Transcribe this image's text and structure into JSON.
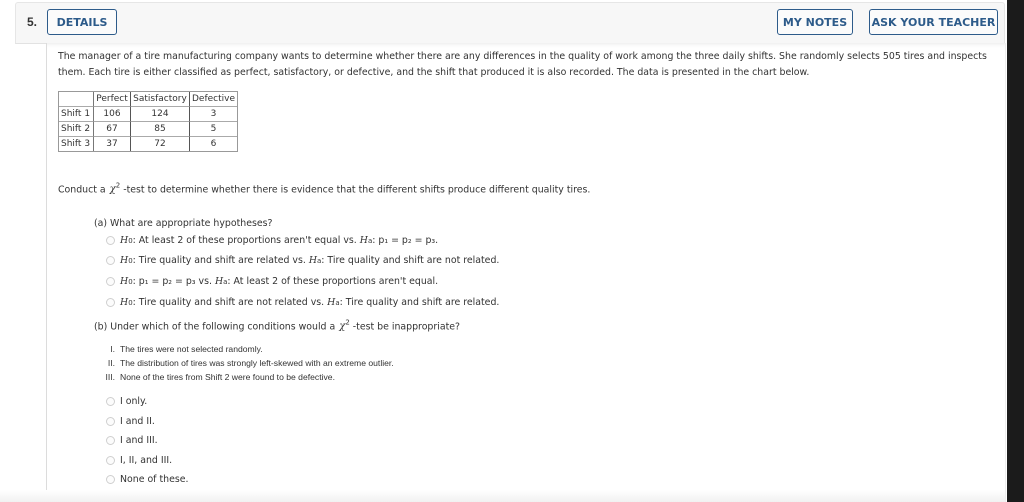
{
  "question": {
    "number": "5.",
    "details_label": "DETAILS",
    "my_notes_label": "MY NOTES",
    "ask_teacher_label": "ASK YOUR TEACHER"
  },
  "intro": "The manager of a tire manufacturing company wants to determine whether there are any differences in the quality of work among the three daily shifts. She randomly selects 505 tires and inspects them. Each tire is either classified as perfect, satisfactory, or defective, and the shift that produced it is also recorded. The data is presented in the chart below.",
  "table": {
    "headers": [
      "",
      "Perfect",
      "Satisfactory",
      "Defective"
    ],
    "rows": [
      [
        "Shift 1",
        "106",
        "124",
        "3"
      ],
      [
        "Shift 2",
        "67",
        "85",
        "5"
      ],
      [
        "Shift 3",
        "37",
        "72",
        "6"
      ]
    ]
  },
  "conduct": {
    "before": "Conduct a",
    "chi": "χ",
    "sup": "2",
    "after": "-test to determine whether there is evidence that the different shifts produce different quality tires."
  },
  "part_a": {
    "prompt": "(a) What are appropriate hypotheses?",
    "options": [
      {
        "h0_label": "H",
        "h0_sub": "0",
        "h0_text": ": At least 2 of these proportions aren't equal vs. ",
        "ha_label": "H",
        "ha_sub": "a",
        "ha_text": ": p₁ = p₂ = p₃."
      },
      {
        "h0_label": "H",
        "h0_sub": "0",
        "h0_text": ": Tire quality and shift are related vs. ",
        "ha_label": "H",
        "ha_sub": "a",
        "ha_text": ": Tire quality and shift are not related."
      },
      {
        "h0_label": "H",
        "h0_sub": "0",
        "h0_text": ": p₁ = p₂ = p₃ vs. ",
        "ha_label": "H",
        "ha_sub": "a",
        "ha_text": ": At least 2 of these proportions aren't equal."
      },
      {
        "h0_label": "H",
        "h0_sub": "0",
        "h0_text": ": Tire quality and shift are not related vs. ",
        "ha_label": "H",
        "ha_sub": "a",
        "ha_text": ": Tire quality and shift are related."
      }
    ]
  },
  "part_b": {
    "prompt_before": "(b) Under which of the following conditions would a",
    "chi": "χ",
    "sup": "2",
    "prompt_after": "-test be inappropriate?",
    "conditions": [
      {
        "num": "I.",
        "text": "The tires were not selected randomly."
      },
      {
        "num": "II.",
        "text": "The distribution of tires was strongly left-skewed with an extreme outlier."
      },
      {
        "num": "III.",
        "text": "None of the tires from Shift 2 were found to be defective."
      }
    ],
    "options": [
      "I only.",
      "I and II.",
      "I and III.",
      "I, II, and III.",
      "None of these."
    ]
  }
}
